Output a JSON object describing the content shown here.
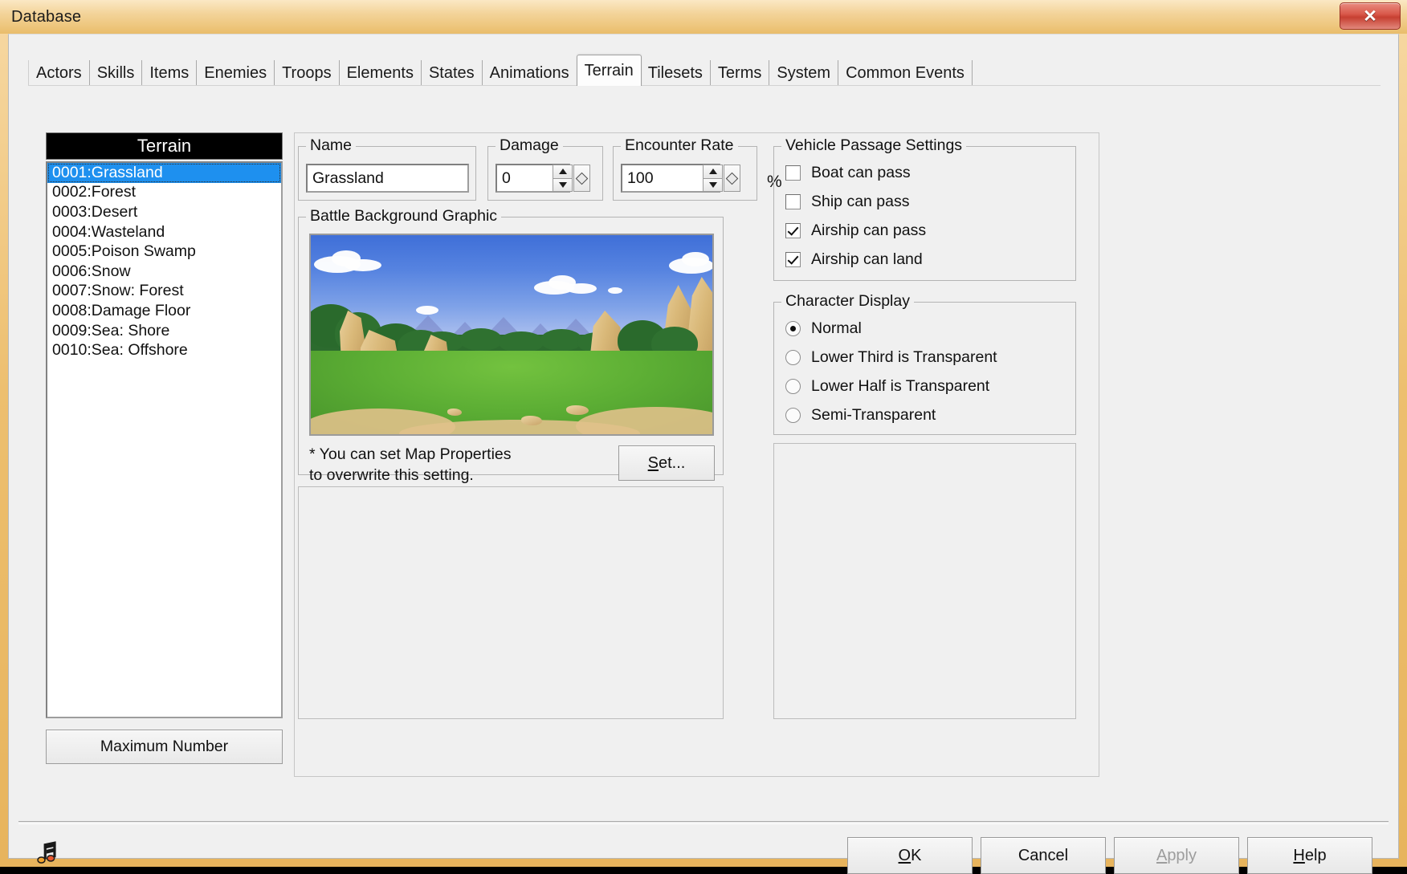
{
  "window": {
    "title": "Database",
    "close_label": "✕"
  },
  "tabs": [
    {
      "label": "Actors",
      "active": false
    },
    {
      "label": "Skills",
      "active": false
    },
    {
      "label": "Items",
      "active": false
    },
    {
      "label": "Enemies",
      "active": false
    },
    {
      "label": "Troops",
      "active": false
    },
    {
      "label": "Elements",
      "active": false
    },
    {
      "label": "States",
      "active": false
    },
    {
      "label": "Animations",
      "active": false
    },
    {
      "label": "Terrain",
      "active": true
    },
    {
      "label": "Tilesets",
      "active": false
    },
    {
      "label": "Terms",
      "active": false
    },
    {
      "label": "System",
      "active": false
    },
    {
      "label": "Common Events",
      "active": false
    }
  ],
  "list": {
    "header": "Terrain",
    "items": [
      {
        "label": "0001:Grassland",
        "selected": true
      },
      {
        "label": "0002:Forest",
        "selected": false
      },
      {
        "label": "0003:Desert",
        "selected": false
      },
      {
        "label": "0004:Wasteland",
        "selected": false
      },
      {
        "label": "0005:Poison Swamp",
        "selected": false
      },
      {
        "label": "0006:Snow",
        "selected": false
      },
      {
        "label": "0007:Snow: Forest",
        "selected": false
      },
      {
        "label": "0008:Damage Floor",
        "selected": false
      },
      {
        "label": "0009:Sea: Shore",
        "selected": false
      },
      {
        "label": "0010:Sea: Offshore",
        "selected": false
      }
    ],
    "max_number_button": "Maximum Number"
  },
  "fields": {
    "name_legend": "Name",
    "name_value": "Grassland",
    "damage_legend": "Damage",
    "damage_value": "0",
    "encounter_legend": "Encounter Rate",
    "encounter_value": "100",
    "percent_symbol": "%"
  },
  "battle_bg": {
    "legend": "Battle Background Graphic",
    "note": "* You can set Map Properties\nto overwrite this setting.",
    "set_button": "Set..."
  },
  "vehicle_passage": {
    "legend": "Vehicle Passage Settings",
    "options": [
      {
        "label": "Boat can pass",
        "checked": false
      },
      {
        "label": "Ship can pass",
        "checked": false
      },
      {
        "label": "Airship can pass",
        "checked": true
      },
      {
        "label": "Airship can land",
        "checked": true
      }
    ]
  },
  "character_display": {
    "legend": "Character Display",
    "options": [
      {
        "label": "Normal",
        "selected": true
      },
      {
        "label": "Lower Third is Transparent",
        "selected": false
      },
      {
        "label": "Lower Half is Transparent",
        "selected": false
      },
      {
        "label": "Semi-Transparent",
        "selected": false
      }
    ]
  },
  "footer": {
    "ok": "OK",
    "cancel": "Cancel",
    "apply": "Apply",
    "help": "Help",
    "apply_disabled": true,
    "music_icon": "music-note-icon"
  },
  "colors": {
    "title_bar": "#eec77f",
    "close_button": "#c63f31",
    "selection": "#1e90ef",
    "panel": "#f0f0f0",
    "list_header_bg": "#000000"
  }
}
